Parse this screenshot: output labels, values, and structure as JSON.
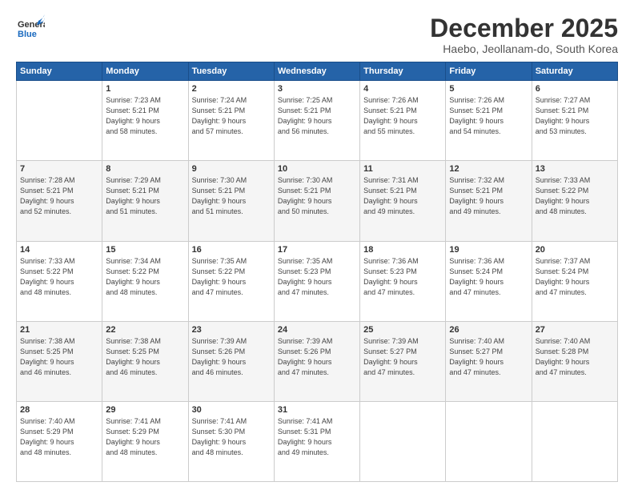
{
  "header": {
    "logo_general": "General",
    "logo_blue": "Blue",
    "month": "December 2025",
    "location": "Haebo, Jeollanam-do, South Korea"
  },
  "weekdays": [
    "Sunday",
    "Monday",
    "Tuesday",
    "Wednesday",
    "Thursday",
    "Friday",
    "Saturday"
  ],
  "weeks": [
    [
      {
        "day": "",
        "sunrise": "",
        "sunset": "",
        "daylight": ""
      },
      {
        "day": "1",
        "sunrise": "Sunrise: 7:23 AM",
        "sunset": "Sunset: 5:21 PM",
        "daylight": "Daylight: 9 hours and 58 minutes."
      },
      {
        "day": "2",
        "sunrise": "Sunrise: 7:24 AM",
        "sunset": "Sunset: 5:21 PM",
        "daylight": "Daylight: 9 hours and 57 minutes."
      },
      {
        "day": "3",
        "sunrise": "Sunrise: 7:25 AM",
        "sunset": "Sunset: 5:21 PM",
        "daylight": "Daylight: 9 hours and 56 minutes."
      },
      {
        "day": "4",
        "sunrise": "Sunrise: 7:26 AM",
        "sunset": "Sunset: 5:21 PM",
        "daylight": "Daylight: 9 hours and 55 minutes."
      },
      {
        "day": "5",
        "sunrise": "Sunrise: 7:26 AM",
        "sunset": "Sunset: 5:21 PM",
        "daylight": "Daylight: 9 hours and 54 minutes."
      },
      {
        "day": "6",
        "sunrise": "Sunrise: 7:27 AM",
        "sunset": "Sunset: 5:21 PM",
        "daylight": "Daylight: 9 hours and 53 minutes."
      }
    ],
    [
      {
        "day": "7",
        "sunrise": "Sunrise: 7:28 AM",
        "sunset": "Sunset: 5:21 PM",
        "daylight": "Daylight: 9 hours and 52 minutes."
      },
      {
        "day": "8",
        "sunrise": "Sunrise: 7:29 AM",
        "sunset": "Sunset: 5:21 PM",
        "daylight": "Daylight: 9 hours and 51 minutes."
      },
      {
        "day": "9",
        "sunrise": "Sunrise: 7:30 AM",
        "sunset": "Sunset: 5:21 PM",
        "daylight": "Daylight: 9 hours and 51 minutes."
      },
      {
        "day": "10",
        "sunrise": "Sunrise: 7:30 AM",
        "sunset": "Sunset: 5:21 PM",
        "daylight": "Daylight: 9 hours and 50 minutes."
      },
      {
        "day": "11",
        "sunrise": "Sunrise: 7:31 AM",
        "sunset": "Sunset: 5:21 PM",
        "daylight": "Daylight: 9 hours and 49 minutes."
      },
      {
        "day": "12",
        "sunrise": "Sunrise: 7:32 AM",
        "sunset": "Sunset: 5:21 PM",
        "daylight": "Daylight: 9 hours and 49 minutes."
      },
      {
        "day": "13",
        "sunrise": "Sunrise: 7:33 AM",
        "sunset": "Sunset: 5:22 PM",
        "daylight": "Daylight: 9 hours and 48 minutes."
      }
    ],
    [
      {
        "day": "14",
        "sunrise": "Sunrise: 7:33 AM",
        "sunset": "Sunset: 5:22 PM",
        "daylight": "Daylight: 9 hours and 48 minutes."
      },
      {
        "day": "15",
        "sunrise": "Sunrise: 7:34 AM",
        "sunset": "Sunset: 5:22 PM",
        "daylight": "Daylight: 9 hours and 48 minutes."
      },
      {
        "day": "16",
        "sunrise": "Sunrise: 7:35 AM",
        "sunset": "Sunset: 5:22 PM",
        "daylight": "Daylight: 9 hours and 47 minutes."
      },
      {
        "day": "17",
        "sunrise": "Sunrise: 7:35 AM",
        "sunset": "Sunset: 5:23 PM",
        "daylight": "Daylight: 9 hours and 47 minutes."
      },
      {
        "day": "18",
        "sunrise": "Sunrise: 7:36 AM",
        "sunset": "Sunset: 5:23 PM",
        "daylight": "Daylight: 9 hours and 47 minutes."
      },
      {
        "day": "19",
        "sunrise": "Sunrise: 7:36 AM",
        "sunset": "Sunset: 5:24 PM",
        "daylight": "Daylight: 9 hours and 47 minutes."
      },
      {
        "day": "20",
        "sunrise": "Sunrise: 7:37 AM",
        "sunset": "Sunset: 5:24 PM",
        "daylight": "Daylight: 9 hours and 47 minutes."
      }
    ],
    [
      {
        "day": "21",
        "sunrise": "Sunrise: 7:38 AM",
        "sunset": "Sunset: 5:25 PM",
        "daylight": "Daylight: 9 hours and 46 minutes."
      },
      {
        "day": "22",
        "sunrise": "Sunrise: 7:38 AM",
        "sunset": "Sunset: 5:25 PM",
        "daylight": "Daylight: 9 hours and 46 minutes."
      },
      {
        "day": "23",
        "sunrise": "Sunrise: 7:39 AM",
        "sunset": "Sunset: 5:26 PM",
        "daylight": "Daylight: 9 hours and 46 minutes."
      },
      {
        "day": "24",
        "sunrise": "Sunrise: 7:39 AM",
        "sunset": "Sunset: 5:26 PM",
        "daylight": "Daylight: 9 hours and 47 minutes."
      },
      {
        "day": "25",
        "sunrise": "Sunrise: 7:39 AM",
        "sunset": "Sunset: 5:27 PM",
        "daylight": "Daylight: 9 hours and 47 minutes."
      },
      {
        "day": "26",
        "sunrise": "Sunrise: 7:40 AM",
        "sunset": "Sunset: 5:27 PM",
        "daylight": "Daylight: 9 hours and 47 minutes."
      },
      {
        "day": "27",
        "sunrise": "Sunrise: 7:40 AM",
        "sunset": "Sunset: 5:28 PM",
        "daylight": "Daylight: 9 hours and 47 minutes."
      }
    ],
    [
      {
        "day": "28",
        "sunrise": "Sunrise: 7:40 AM",
        "sunset": "Sunset: 5:29 PM",
        "daylight": "Daylight: 9 hours and 48 minutes."
      },
      {
        "day": "29",
        "sunrise": "Sunrise: 7:41 AM",
        "sunset": "Sunset: 5:29 PM",
        "daylight": "Daylight: 9 hours and 48 minutes."
      },
      {
        "day": "30",
        "sunrise": "Sunrise: 7:41 AM",
        "sunset": "Sunset: 5:30 PM",
        "daylight": "Daylight: 9 hours and 48 minutes."
      },
      {
        "day": "31",
        "sunrise": "Sunrise: 7:41 AM",
        "sunset": "Sunset: 5:31 PM",
        "daylight": "Daylight: 9 hours and 49 minutes."
      },
      {
        "day": "",
        "sunrise": "",
        "sunset": "",
        "daylight": ""
      },
      {
        "day": "",
        "sunrise": "",
        "sunset": "",
        "daylight": ""
      },
      {
        "day": "",
        "sunrise": "",
        "sunset": "",
        "daylight": ""
      }
    ]
  ]
}
